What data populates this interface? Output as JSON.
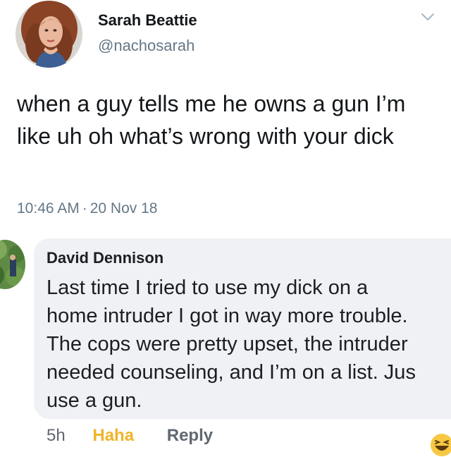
{
  "tweet": {
    "author_name": "Sarah Beattie",
    "author_handle": "@nachosarah",
    "text": "when a guy tells me he owns a gun I’m like uh oh what’s wrong with your dick",
    "time": "10:46 AM",
    "separator": "·",
    "date": "20 Nov 18",
    "menu_icon": "chevron-down-icon"
  },
  "comment": {
    "author_name": "David Dennison",
    "lines": [
      "Last time I tried to use my dick on a",
      "home intruder I got in way more trouble.",
      "The cops were pretty upset, the intruder",
      "needed counseling, and I’m on a list. Jus",
      "use a gun."
    ],
    "time": "5h",
    "reaction_label": "Haha",
    "reply_label": "Reply",
    "reaction_icon": "haha-emoji-icon"
  },
  "colors": {
    "tweet_secondary": "#657786",
    "comment_bubble": "#eff1f4",
    "haha_reaction": "#f0b429"
  }
}
